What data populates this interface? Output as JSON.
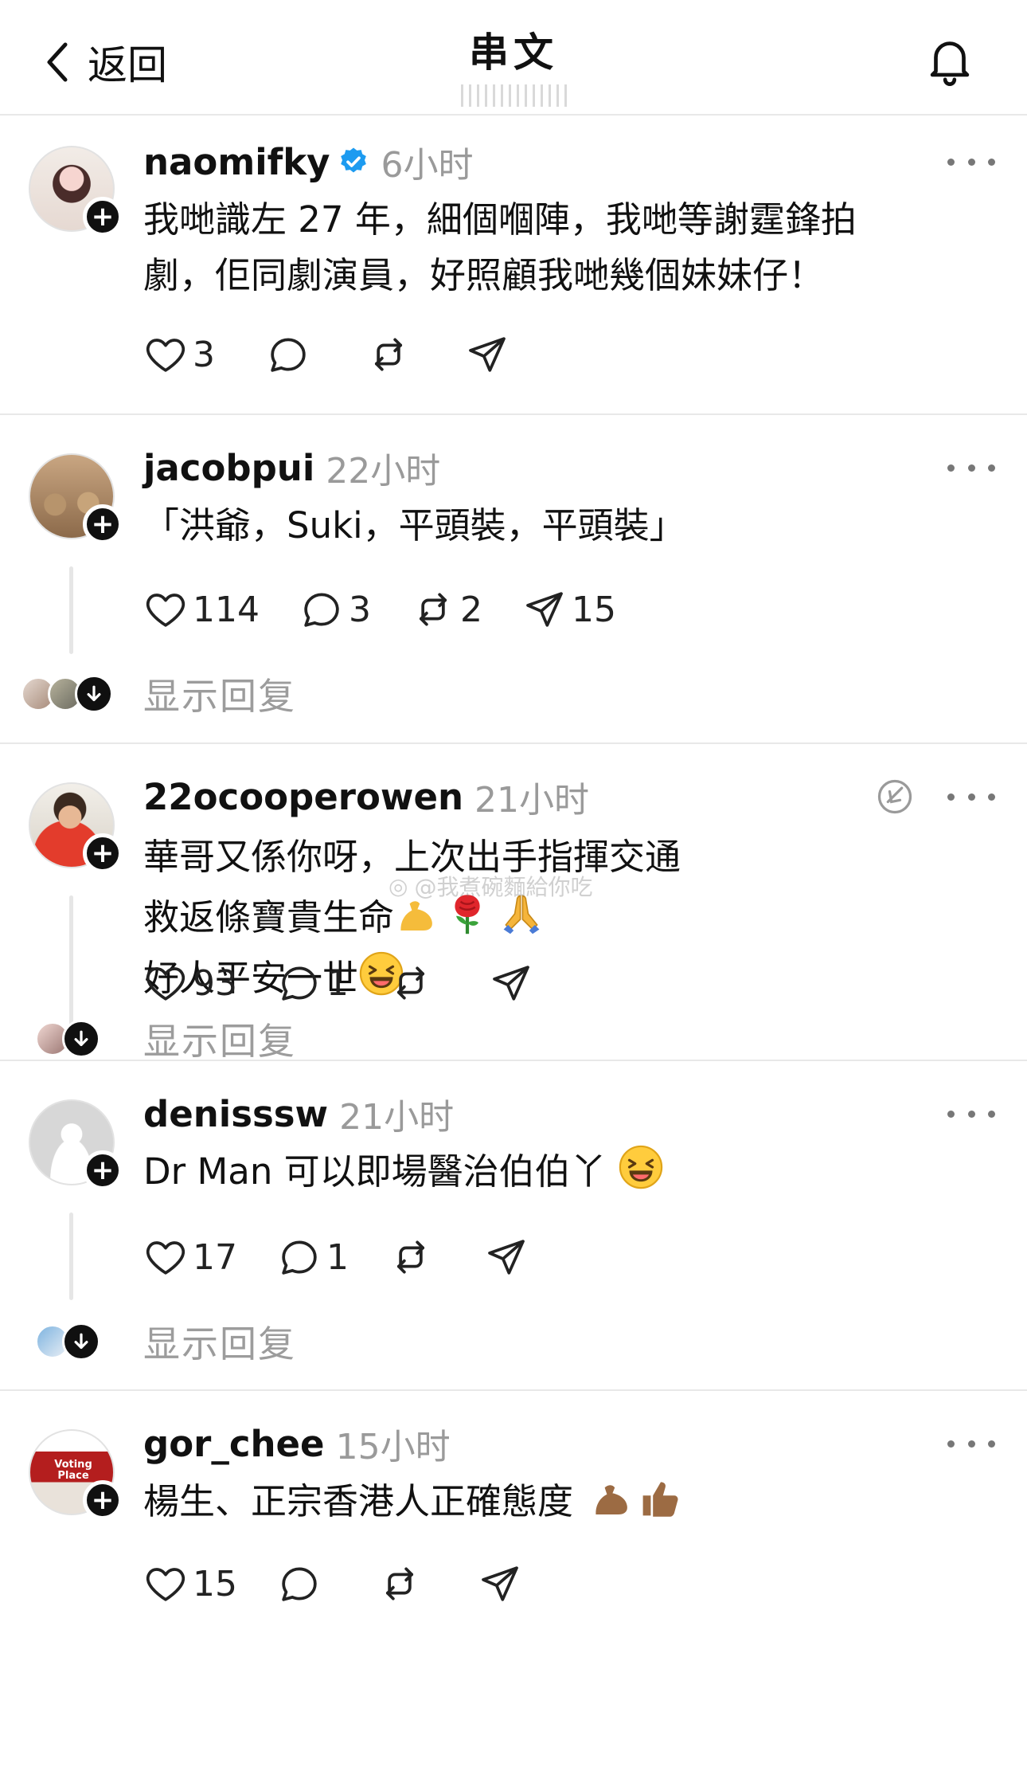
{
  "header": {
    "back_label": "返回",
    "title": "串文"
  },
  "watermark": "@我煮碗麵給你吃",
  "posts": [
    {
      "username": "naomifky",
      "verified": true,
      "time": "6小时",
      "lines": [
        "我哋識左 27 年，細個嗰陣，我哋等謝霆鋒拍",
        "劇，佢同劇演員，好照顧我哋幾個妹妹仔！"
      ],
      "likes": "3",
      "replies": "",
      "reposts": "",
      "shares": ""
    },
    {
      "username": "jacobpui",
      "time": "22小时",
      "lines": [
        "「洪爺，Suki，平頭裝，平頭裝」"
      ],
      "likes": "114",
      "replies": "3",
      "reposts": "2",
      "shares": "15",
      "show_replies": "显示回复"
    },
    {
      "username": "22ocooperowen",
      "time": "21小时",
      "line1": "華哥又係你呀，上次出手指揮交通",
      "line2": "救返條寶貴生命",
      "line3": "好人平安一世",
      "likes": "93",
      "replies": "1",
      "reposts": "",
      "shares": "",
      "show_replies": "显示回复"
    },
    {
      "username": "denisssw",
      "time": "21小时",
      "line1": "Dr Man 可以即場醫治伯伯丫",
      "likes": "17",
      "replies": "1",
      "reposts": "",
      "shares": "",
      "show_replies": "显示回复"
    },
    {
      "username": "gor_chee",
      "time": "15小时",
      "line1": "楊生、正宗香港人正確態度",
      "avatar_sign": "Voting Place",
      "likes": "15",
      "replies": "",
      "reposts": "",
      "shares": ""
    }
  ],
  "icons": {
    "back": "chevron-left-icon",
    "bell": "bell-icon",
    "like": "heart-icon",
    "reply": "comment-icon",
    "repost": "repost-icon",
    "share": "send-icon"
  },
  "colors": {
    "verified": "#1d9bf0",
    "muted_text": "#9a9a9a",
    "divider": "#e8e8e8"
  }
}
